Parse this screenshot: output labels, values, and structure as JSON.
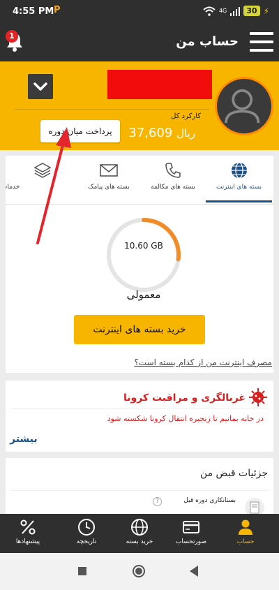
{
  "status_bar": {
    "time": "4:55 PM",
    "carrier_glyph": "P",
    "network": "4G",
    "battery": "30",
    "icons": [
      "wifi-icon",
      "signal-icon",
      "battery-icon",
      "charging-icon"
    ]
  },
  "app_bar": {
    "title": "حساب من",
    "notification_count": "1",
    "icons": [
      "bell-icon",
      "hamburger-menu-icon"
    ]
  },
  "account": {
    "usage_label": "کارکرد کل",
    "usage_amount": "37,609",
    "currency": "ریال",
    "mid_period_payment_button": "پرداخت میان دوره",
    "colors": {
      "header_bg": "#f7b500",
      "avatar_ring": "#ff8c00"
    }
  },
  "tabs": {
    "items": [
      {
        "label": "بسته های اینترنت",
        "icon": "globe-icon",
        "active": true
      },
      {
        "label": "بسته های مکالمه",
        "icon": "phone-icon",
        "active": false
      },
      {
        "label": "بسته های پیامک",
        "icon": "envelope-icon",
        "active": false
      },
      {
        "label": "خدمات",
        "icon": "layers-icon",
        "active": false
      }
    ]
  },
  "internet": {
    "remaining": "10.60 GB",
    "remaining_fraction": 0.27,
    "package_type": "معمولی",
    "buy_button": "خرید بسته های اینترنت",
    "usage_question_link": "مصرف اینترنت من از کدام بسته است؟"
  },
  "corona": {
    "title": "غربالگری و مراقبت کرونا",
    "text": "در خانه بمانیم تا زنجیره انتقال کرونا شکسته شود",
    "more_link": "بیشتر",
    "icon": "virus-icon"
  },
  "bill": {
    "title": "جزئیات قبض من",
    "first_item": "بستانکاری دوره قبل"
  },
  "bottom_nav": {
    "items": [
      {
        "label": "پیشنهادها",
        "icon": "percent-icon",
        "active": false
      },
      {
        "label": "تاریخچه",
        "icon": "clock-icon",
        "active": false
      },
      {
        "label": "خرید بسته",
        "icon": "globe-icon",
        "active": false
      },
      {
        "label": "صورتحساب",
        "icon": "card-icon",
        "active": false
      },
      {
        "label": "حساب",
        "icon": "user-icon",
        "active": true
      }
    ],
    "active_color": "#f7b500"
  },
  "system_nav": {
    "icons": [
      "recents-icon",
      "home-icon",
      "back-icon"
    ]
  },
  "colors": {
    "dark_bar": "#2f2f2f",
    "accent_blue": "#1b4f8a",
    "alert_red": "#d62020",
    "annotation_arrow": "#e3262d"
  }
}
